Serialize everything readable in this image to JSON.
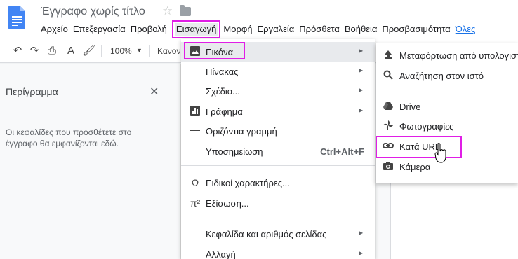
{
  "doc": {
    "title": "Έγγραφο χωρίς τίτλο"
  },
  "menubar": {
    "items": [
      "Αρχείο",
      "Επεξεργασία",
      "Προβολή",
      "Εισαγωγή",
      "Μορφή",
      "Εργαλεία",
      "Πρόσθετα",
      "Βοήθεια",
      "Προσβασιμότητα"
    ],
    "link": "Όλες"
  },
  "toolbar": {
    "zoom": "100%",
    "style": "Κανονι"
  },
  "outline": {
    "title": "Περίγραμμα",
    "hint": "Οι κεφαλίδες που προσθέτετε στο έγγραφο θα εμφανίζονται εδώ."
  },
  "insert_menu": {
    "items": [
      {
        "label": "Εικόνα",
        "icon": "image-icon"
      },
      {
        "label": "Πίνακας"
      },
      {
        "label": "Σχέδιο..."
      },
      {
        "label": "Γράφημα",
        "icon": "chart-icon"
      },
      {
        "label": "Οριζόντια γραμμή",
        "icon": "horizontal-line-icon"
      },
      {
        "label": "Υποσημείωση",
        "shortcut": "Ctrl+Alt+F"
      },
      {
        "label": "Ειδικοί χαρακτήρες...",
        "icon": "omega-icon"
      },
      {
        "label": "Εξίσωση...",
        "icon": "pi-icon"
      },
      {
        "label": "Κεφαλίδα και αριθμός σελίδας"
      },
      {
        "label": "Αλλαγή"
      }
    ]
  },
  "image_submenu": {
    "items": [
      {
        "label": "Μεταφόρτωση από υπολογιστή",
        "icon": "upload-icon"
      },
      {
        "label": "Αναζήτηση στον ιστό",
        "icon": "search-icon"
      },
      {
        "label": "Drive",
        "icon": "drive-icon"
      },
      {
        "label": "Φωτογραφίες",
        "icon": "photos-icon"
      },
      {
        "label": "Κατά URL",
        "icon": "link-icon"
      },
      {
        "label": "Κάμερα",
        "icon": "camera-icon"
      }
    ]
  },
  "colors": {
    "highlight": "#e01ee6",
    "doc_blue": "#4285f4",
    "link": "#1a73e8"
  }
}
